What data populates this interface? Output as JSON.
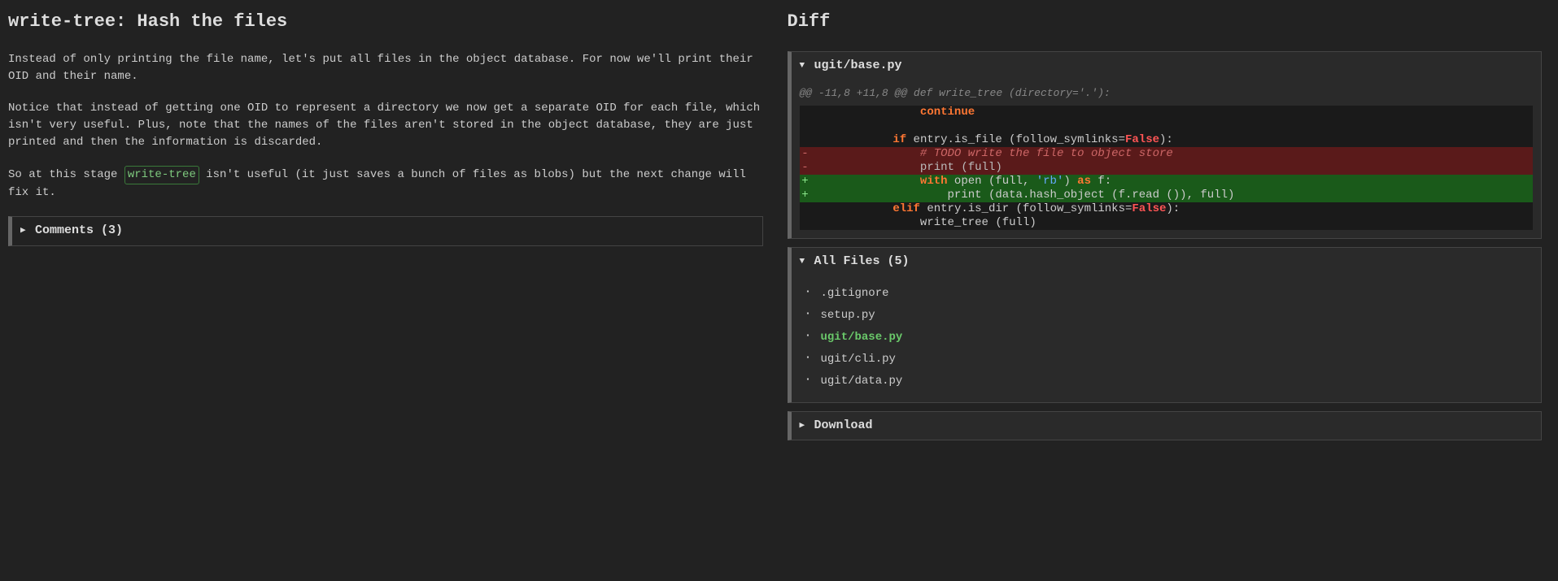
{
  "left": {
    "title": "write-tree: Hash the files",
    "para1": "Instead of only printing the file name, let's put all files in the object database. For now we'll print their OID and their name.",
    "para2": "Notice that instead of getting one OID to represent a directory we now get a separate OID for each file, which isn't very useful. Plus, note that the names of the files aren't stored in the object database, they are just printed and then the information is discarded.",
    "para3_pre": "So at this stage ",
    "para3_kw": "write-tree",
    "para3_post": " isn't useful (it just saves a bunch of files as blobs) but the next change will fix it.",
    "comments_label": "Comments (3)"
  },
  "right": {
    "heading": "Diff",
    "file_header": "ugit/base.py",
    "hunk": "@@ -11,8 +11,8 @@ def write_tree (directory='.'):",
    "lines": [
      {
        "type": "ctx",
        "indent": 16,
        "tokens": [
          {
            "cls": "tk-kw",
            "t": "continue"
          }
        ]
      },
      {
        "type": "ctx",
        "indent": 0,
        "tokens": []
      },
      {
        "type": "ctx",
        "indent": 12,
        "tokens": [
          {
            "cls": "tk-kw",
            "t": "if"
          },
          {
            "t": " entry.is_file (follow_symlinks="
          },
          {
            "cls": "tk-const",
            "t": "False"
          },
          {
            "t": "):"
          }
        ]
      },
      {
        "type": "del",
        "indent": 16,
        "tokens": [
          {
            "cls": "tk-com",
            "t": "# TODO write the file to object store"
          }
        ]
      },
      {
        "type": "del",
        "indent": 16,
        "tokens": [
          {
            "t": "print (full)"
          }
        ]
      },
      {
        "type": "add",
        "indent": 16,
        "tokens": [
          {
            "cls": "tk-kw",
            "t": "with"
          },
          {
            "t": " open (full, "
          },
          {
            "cls": "tk-str2",
            "t": "'rb'"
          },
          {
            "t": ") "
          },
          {
            "cls": "tk-kw",
            "t": "as"
          },
          {
            "t": " f:"
          }
        ]
      },
      {
        "type": "add",
        "indent": 20,
        "tokens": [
          {
            "t": "print (data.hash_object (f.read ()), full)"
          }
        ]
      },
      {
        "type": "ctx",
        "indent": 12,
        "tokens": [
          {
            "cls": "tk-kw",
            "t": "elif"
          },
          {
            "t": " entry.is_dir (follow_symlinks="
          },
          {
            "cls": "tk-const",
            "t": "False"
          },
          {
            "t": "):"
          }
        ]
      },
      {
        "type": "ctx",
        "indent": 16,
        "tokens": [
          {
            "t": "write_tree (full)"
          }
        ]
      }
    ],
    "all_files_label": "All Files (5)",
    "files": [
      {
        "name": ".gitignore",
        "changed": false
      },
      {
        "name": "setup.py",
        "changed": false
      },
      {
        "name": "ugit/base.py",
        "changed": true
      },
      {
        "name": "ugit/cli.py",
        "changed": false
      },
      {
        "name": "ugit/data.py",
        "changed": false
      }
    ],
    "download_label": "Download"
  }
}
